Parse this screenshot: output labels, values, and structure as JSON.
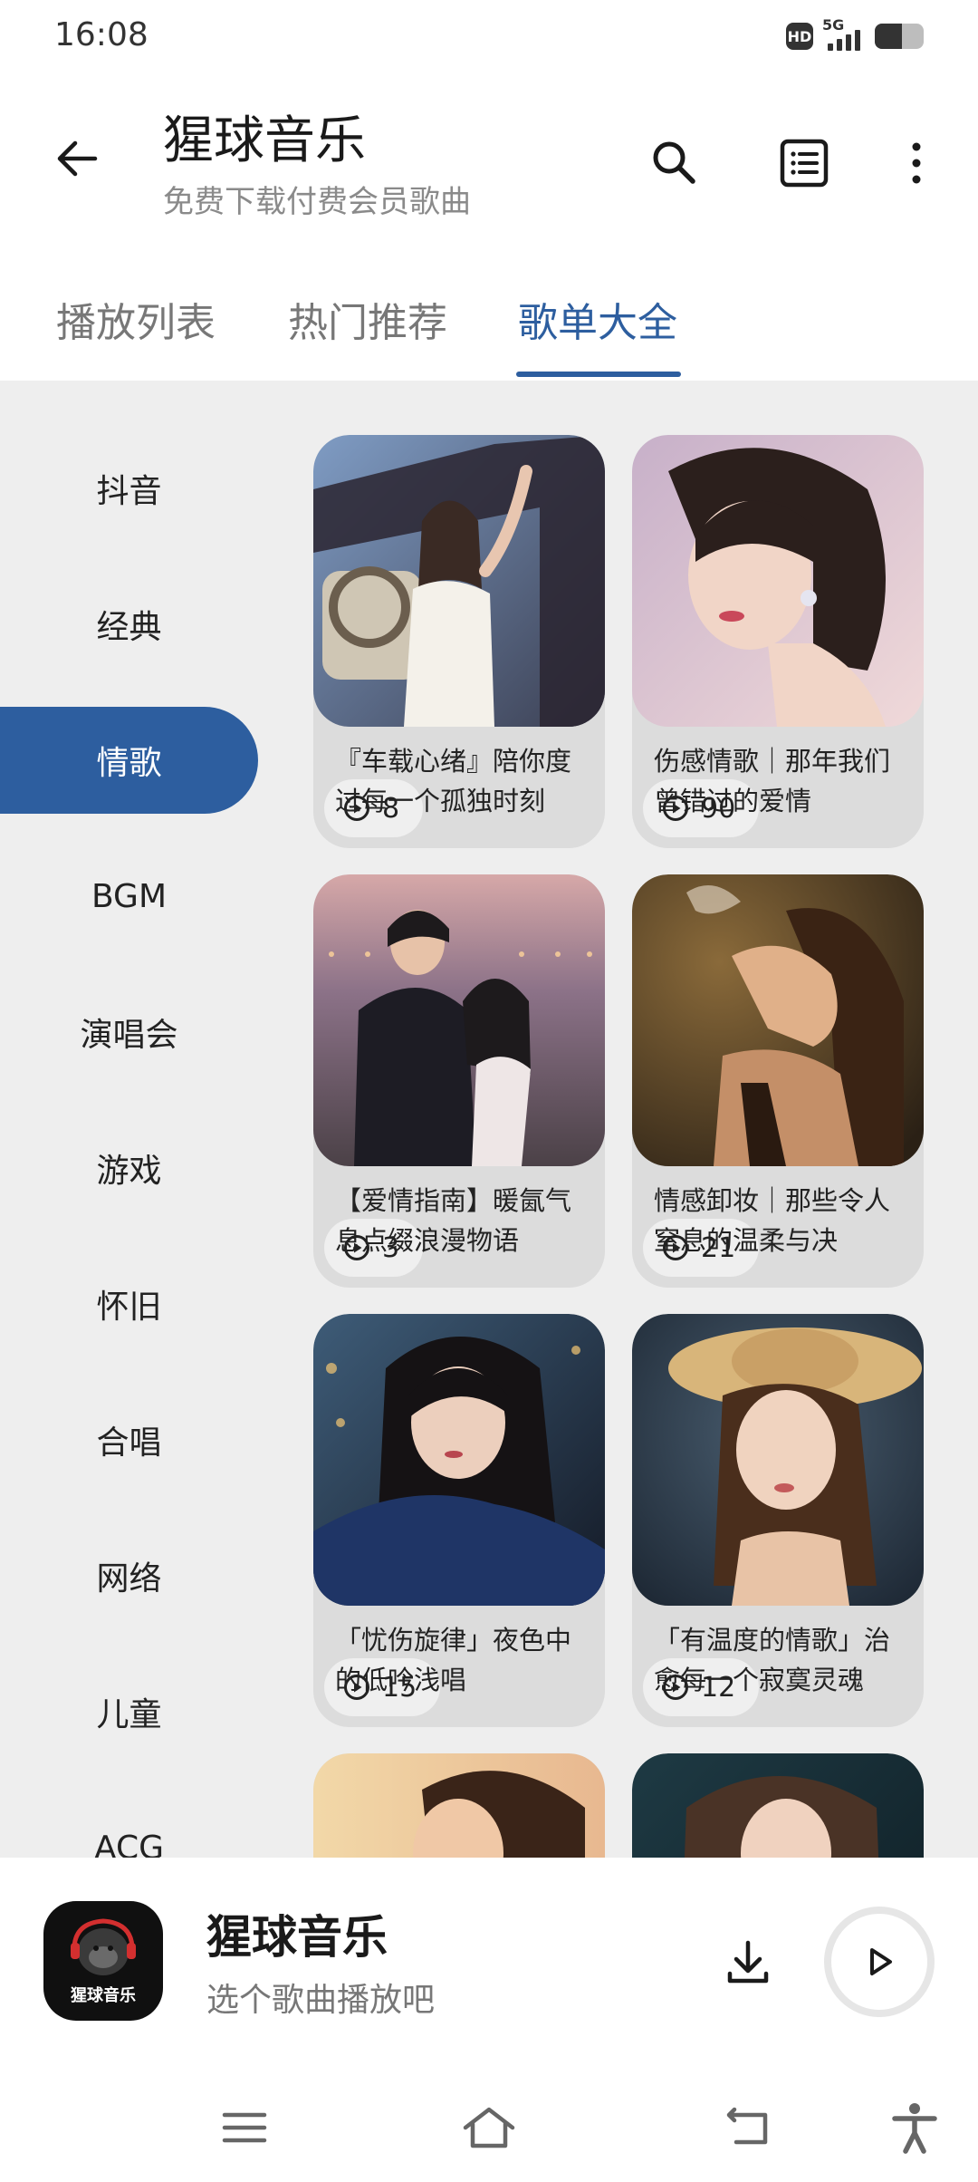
{
  "status_bar": {
    "time": "16:08",
    "hd_badge": "HD",
    "network": "5G",
    "battery_level": 0.55,
    "signal_level": 4
  },
  "header": {
    "title": "猩球音乐",
    "subtitle": "免费下载付费会员歌曲",
    "icons": [
      "back-arrow-icon",
      "search-icon",
      "list-icon",
      "more-vert-icon"
    ]
  },
  "tabs": [
    {
      "label": "播放列表",
      "active": false
    },
    {
      "label": "热门推荐",
      "active": false
    },
    {
      "label": "歌单大全",
      "active": true
    }
  ],
  "categories": [
    {
      "label": "抖音",
      "active": false
    },
    {
      "label": "经典",
      "active": false
    },
    {
      "label": "情歌",
      "active": true
    },
    {
      "label": "BGM",
      "active": false
    },
    {
      "label": "演唱会",
      "active": false
    },
    {
      "label": "游戏",
      "active": false
    },
    {
      "label": "怀旧",
      "active": false
    },
    {
      "label": "合唱",
      "active": false
    },
    {
      "label": "网络",
      "active": false
    },
    {
      "label": "儿童",
      "active": false
    },
    {
      "label": "ACG",
      "active": false
    }
  ],
  "playlists": [
    {
      "count": "8",
      "title": "『车载心绪』陪你度过每一个孤独时刻"
    },
    {
      "count": "90",
      "title": "伤感情歌｜那年我们曾错过的爱情"
    },
    {
      "count": "3",
      "title": "【爱情指南】暖氤气息点缀浪漫物语"
    },
    {
      "count": "21",
      "title": "情感卸妆｜那些令人窒息的温柔与决"
    },
    {
      "count": "15",
      "title": "「忧伤旋律」夜色中的低吟浅唱"
    },
    {
      "count": "12",
      "title": "「有温度的情歌」治愈每一个寂寞灵魂"
    },
    {
      "count": "",
      "title": ""
    },
    {
      "count": "",
      "title": ""
    }
  ],
  "player": {
    "logo_text": "猩球音乐",
    "title": "猩球音乐",
    "subtitle": "选个歌曲播放吧"
  },
  "nav": {
    "icons": [
      "menu-icon",
      "home-icon",
      "back-icon",
      "accessibility-icon"
    ]
  },
  "colors": {
    "accent": "#2d5e9f",
    "content_bg": "#eeeeee",
    "card_bg": "#dcdcdc"
  }
}
